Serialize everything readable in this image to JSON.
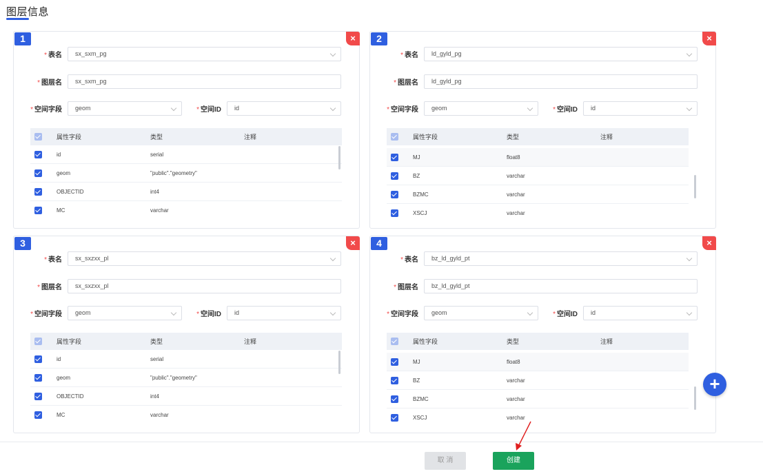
{
  "section": {
    "title": "图层信息"
  },
  "labels": {
    "table_name": "表名",
    "layer_name": "图层名",
    "spatial_field": "空间字段",
    "spatial_id": "空间ID",
    "required_mark": "*"
  },
  "table_headers": {
    "field": "属性字段",
    "type": "类型",
    "comment": "注释"
  },
  "close_label": "×",
  "cards": [
    {
      "number": "1",
      "table_name": "sx_sxm_pg",
      "layer_name": "sx_sxm_pg",
      "spatial_field": "geom",
      "spatial_id": "id",
      "rows": [
        {
          "field": "id",
          "type": "serial"
        },
        {
          "field": "geom",
          "type": "\"public\".\"geometry\""
        },
        {
          "field": "OBJECTID",
          "type": "int4"
        },
        {
          "field": "MC",
          "type": "varchar"
        }
      ]
    },
    {
      "number": "2",
      "table_name": "ld_gyld_pg",
      "layer_name": "ld_gyld_pg",
      "spatial_field": "geom",
      "spatial_id": "id",
      "rows": [
        {
          "field": "MJ",
          "type": "float8"
        },
        {
          "field": "BZ",
          "type": "varchar"
        },
        {
          "field": "BZMC",
          "type": "varchar"
        },
        {
          "field": "XSCJ",
          "type": "varchar"
        }
      ]
    },
    {
      "number": "3",
      "table_name": "sx_sxzxx_pl",
      "layer_name": "sx_sxzxx_pl",
      "spatial_field": "geom",
      "spatial_id": "id",
      "rows": [
        {
          "field": "id",
          "type": "serial"
        },
        {
          "field": "geom",
          "type": "\"public\".\"geometry\""
        },
        {
          "field": "OBJECTID",
          "type": "int4"
        },
        {
          "field": "MC",
          "type": "varchar"
        }
      ]
    },
    {
      "number": "4",
      "table_name": "bz_ld_gyld_pt",
      "layer_name": "bz_ld_gyld_pt",
      "spatial_field": "geom",
      "spatial_id": "id",
      "rows": [
        {
          "field": "MJ",
          "type": "float8"
        },
        {
          "field": "BZ",
          "type": "varchar"
        },
        {
          "field": "BZMC",
          "type": "varchar"
        },
        {
          "field": "XSCJ",
          "type": "varchar"
        }
      ]
    }
  ],
  "add_label": "+",
  "footer": {
    "cancel_label": "取 消",
    "create_label": "创建"
  },
  "colors": {
    "accent": "#2f5fe0",
    "danger": "#f14a4a",
    "success": "#1aa35c",
    "arrow": "#e02020"
  },
  "icons": {
    "close": "close-icon",
    "add": "plus-icon",
    "chevron": "chevron-down-icon",
    "check": "checkbox-icon"
  }
}
